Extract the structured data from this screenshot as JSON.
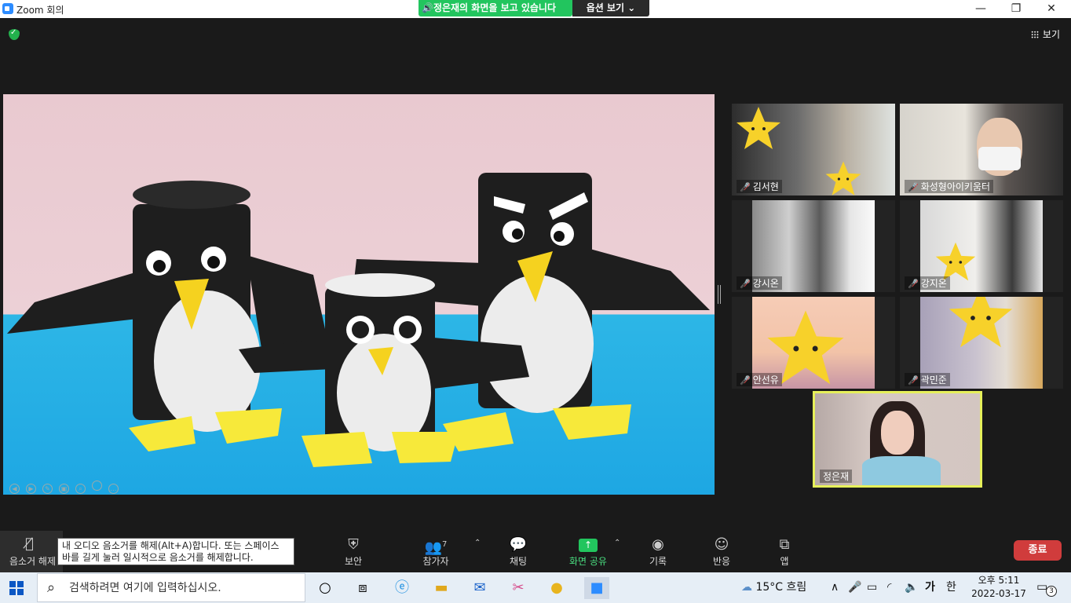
{
  "window": {
    "title": "Zoom 회의",
    "minimize": "—",
    "restore": "❐",
    "close": "✕"
  },
  "banner": {
    "sharing_text": "🔊정은재의 화면을 보고 있습니다",
    "view_options": "옵션 보기 ⌄"
  },
  "meeting": {
    "view_label": "보기"
  },
  "participants": [
    {
      "name": "김서현",
      "muted": true
    },
    {
      "name": "화성형아이키움터",
      "muted": true
    },
    {
      "name": "강시온",
      "muted": true
    },
    {
      "name": "강지온",
      "muted": true
    },
    {
      "name": "안선유",
      "muted": true
    },
    {
      "name": "곽민준",
      "muted": true
    },
    {
      "name": "정은재",
      "muted": false
    }
  ],
  "toolbar": {
    "mute_label": "음소거 해제",
    "tooltip": "내 오디오 음소거를 해제(Alt+A)합니다. 또는 스페이스 바를 길게 눌러 일시적으로 음소거를 해제합니다.",
    "security": "보안",
    "participants": "참가자",
    "participant_count": "7",
    "chat": "채팅",
    "share_screen": "화면 공유",
    "record": "기록",
    "reactions": "반응",
    "apps": "앱",
    "end": "종료"
  },
  "taskbar": {
    "search_placeholder": "검색하려면 여기에 입력하십시오.",
    "weather": "15°C  흐림",
    "ime": "가",
    "ime2": "한",
    "time": "오후 5:11",
    "date": "2022-03-17",
    "notification_count": "3"
  },
  "colors": {
    "accent_green": "#22c55e",
    "end_red": "#d03c3c",
    "active_speaker": "#e6f05a"
  }
}
